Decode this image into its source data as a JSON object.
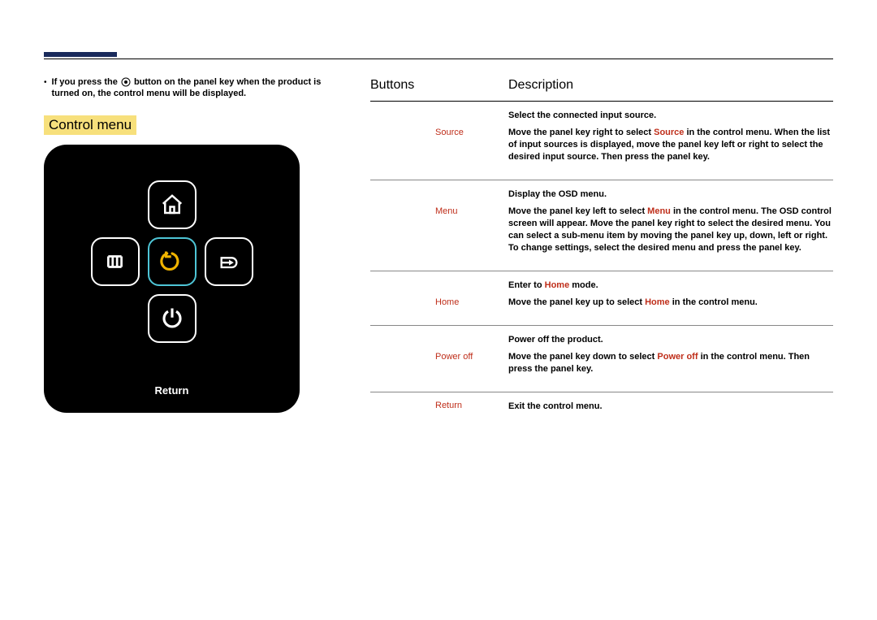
{
  "intro_pre": "If you press the ",
  "intro_post": " button on the panel key when the product is turned on, the control menu will be displayed.",
  "section_title": "Control menu",
  "device_label": "Return",
  "columns": {
    "buttons": "Buttons",
    "description": "Description"
  },
  "rows": {
    "source": {
      "label": "Source",
      "p1": "Select the connected input source.",
      "p2a": "Move the panel key right to select ",
      "hl": "Source",
      "p2b": " in the control menu. When the list of input sources is displayed, move the panel key left or right to select the desired input source. Then press the panel key."
    },
    "menu": {
      "label": "Menu",
      "p1": "Display the OSD menu.",
      "p2a": "Move the panel key left to select ",
      "hl": "Menu",
      "p2b": " in the control menu. The OSD control screen will appear. Move the panel key right to select the desired menu. You can select a sub-menu item by moving the panel key up, down, left or right. To change settings, select the desired menu and press the panel key."
    },
    "home": {
      "label": "Home",
      "p1a": "Enter to ",
      "p1hl": "Home",
      "p1b": " mode.",
      "p2a": "Move the panel key up to select ",
      "hl": "Home",
      "p2b": " in the control menu."
    },
    "power": {
      "label": "Power off",
      "p1": "Power off the product.",
      "p2a": "Move the panel key down to select ",
      "hl": "Power off",
      "p2b": " in the control menu. Then press the panel key."
    },
    "return": {
      "label": "Return",
      "p1": "Exit the control menu."
    }
  }
}
